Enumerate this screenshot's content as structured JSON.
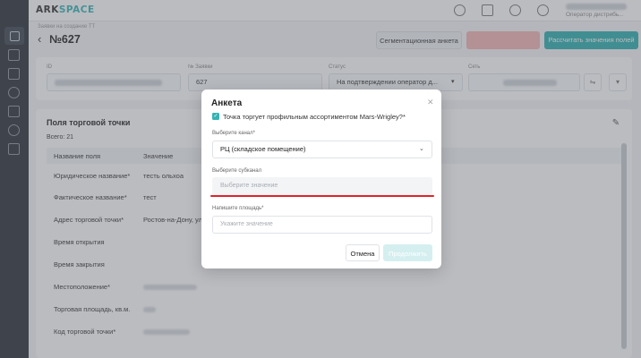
{
  "app": {
    "logo_left": "ARK",
    "logo_right": "SPACE",
    "user_role": "Оператор дистрибь..."
  },
  "header": {
    "breadcrumb": "Заявки на создание ТТ",
    "back_icon": "arrow-left-icon",
    "title": "№627",
    "segmentation_button": "Сегментационная анкета",
    "calculate_button": "Рассчитать значения полей"
  },
  "info": {
    "id_label": "ID",
    "request_no_label": "№ Заявки",
    "request_no": "627",
    "status_label": "Статус",
    "status_value": "На подтверждении оператор д...",
    "network_label": "Сеть"
  },
  "outlet": {
    "title": "Поля торговой точки",
    "total": "Всего: 21",
    "col_name": "Название поля",
    "col_value": "Значение",
    "rows": [
      {
        "name": "Юридическое название*",
        "value": "тесть ольхоа"
      },
      {
        "name": "Фактическое название*",
        "value": "тест"
      },
      {
        "name": "Адрес торговой точки*",
        "value": "Ростов-на-Дону, ул"
      },
      {
        "name": "Время открытия",
        "value": ""
      },
      {
        "name": "Время закрытия",
        "value": ""
      },
      {
        "name": "Местоположение*",
        "value": ""
      },
      {
        "name": "Торговая площадь, кв.м.",
        "value": ""
      },
      {
        "name": "Код торговой точки*",
        "value": ""
      }
    ]
  },
  "modal": {
    "title": "Анкета",
    "close_icon": "close-icon",
    "checkbox_label": "Точка торгует профильным ассортиментом Mars-Wrigley?*",
    "channel_label": "Выберите канал*",
    "channel_value": "РЦ (складское помещение)",
    "subchannel_label": "Выберите субканал",
    "subchannel_placeholder": "Выберите значение",
    "area_label": "Напишите площадь*",
    "area_placeholder": "Укажите значение",
    "cancel": "Отмена",
    "continue": "Продолжить"
  },
  "colors": {
    "accent": "#2fb0b0",
    "error_underline": "#e0232c",
    "sidebar": "#2b2f36"
  }
}
